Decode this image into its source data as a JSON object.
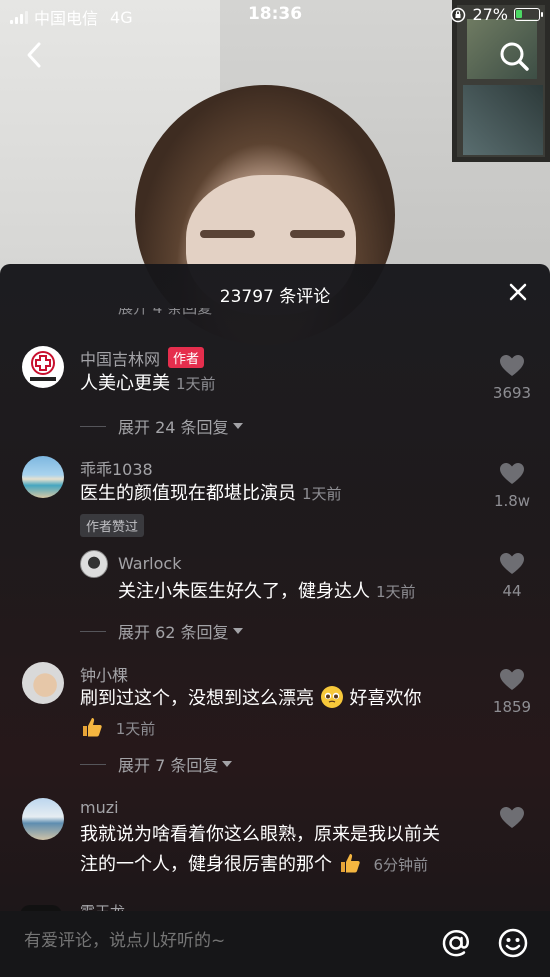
{
  "status_bar": {
    "carrier": "中国电信",
    "network": "4G",
    "time": "18:36",
    "battery": "27%",
    "battery_level": 0.27
  },
  "sheet": {
    "title": "23797 条评论",
    "partial_top_text": "展开 4 条回复"
  },
  "comments": [
    {
      "user": "中国吉林网",
      "author_badge": "作者",
      "text": "人美心更美",
      "time": "1天前",
      "likes": "3693",
      "expand": "展开 24 条回复",
      "avatar_text": "中国吉林网"
    },
    {
      "user": "乖乖1038",
      "text": "医生的颜值现在都堪比演员",
      "time": "1天前",
      "likes": "1.8w",
      "liked_by_author": "作者赞过"
    },
    {
      "user": "Warlock",
      "text": "关注小朱医生好久了，健身达人",
      "time": "1天前",
      "likes": "44",
      "expand": "展开 62 条回复",
      "reply": true
    },
    {
      "user": "钟小棵",
      "text": "刷到过这个，没想到这么漂亮",
      "text2": "好喜欢你",
      "time": "1天前",
      "likes": "1859",
      "expand": "展开 7 条回复"
    },
    {
      "user": "muzi",
      "text": "我就说为啥看着你这么眼熟，原来是我以前关",
      "text2": "注的一个人，健身很厉害的那个",
      "time": "6分钟前"
    }
  ],
  "peek_user": "霸王龙",
  "input": {
    "placeholder": "有爱评论，说点儿好听的~"
  },
  "icons": {
    "back": "back-chevron-icon",
    "search": "search-icon",
    "close": "close-icon",
    "heart": "heart-icon",
    "at": "at-icon",
    "emoji": "emoji-icon"
  },
  "colors": {
    "author_badge": "#e52e4d",
    "battery_fill": "#4cd964"
  }
}
